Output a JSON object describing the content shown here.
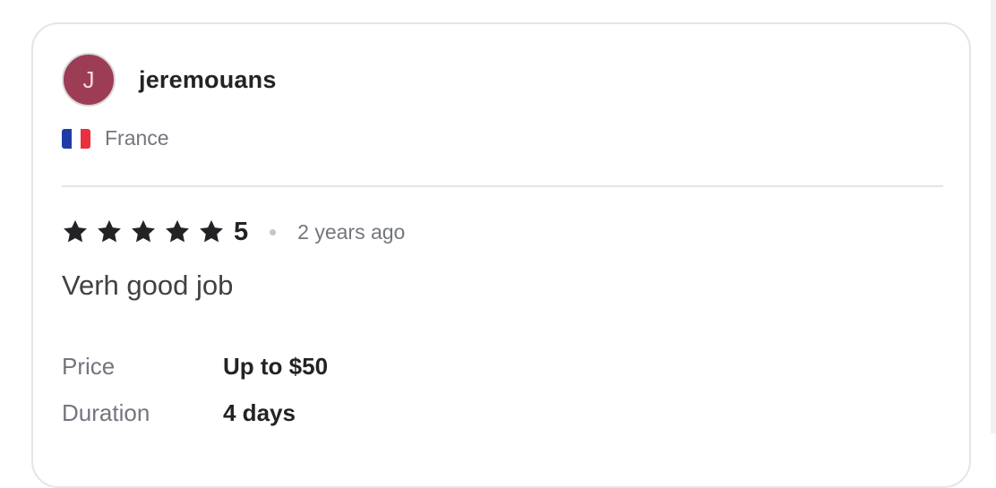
{
  "review": {
    "avatar_initial": "J",
    "username": "jeremouans",
    "country": "France",
    "flag_colors": [
      "#1f3ca6",
      "#ffffff",
      "#e8303f"
    ],
    "avatar_color": "#9c3d55",
    "rating": 5,
    "rating_label": "5",
    "time_ago": "2 years ago",
    "text": "Verh good job",
    "details": [
      {
        "label": "Price",
        "value": "Up to $50"
      },
      {
        "label": "Duration",
        "value": "4 days"
      }
    ]
  }
}
